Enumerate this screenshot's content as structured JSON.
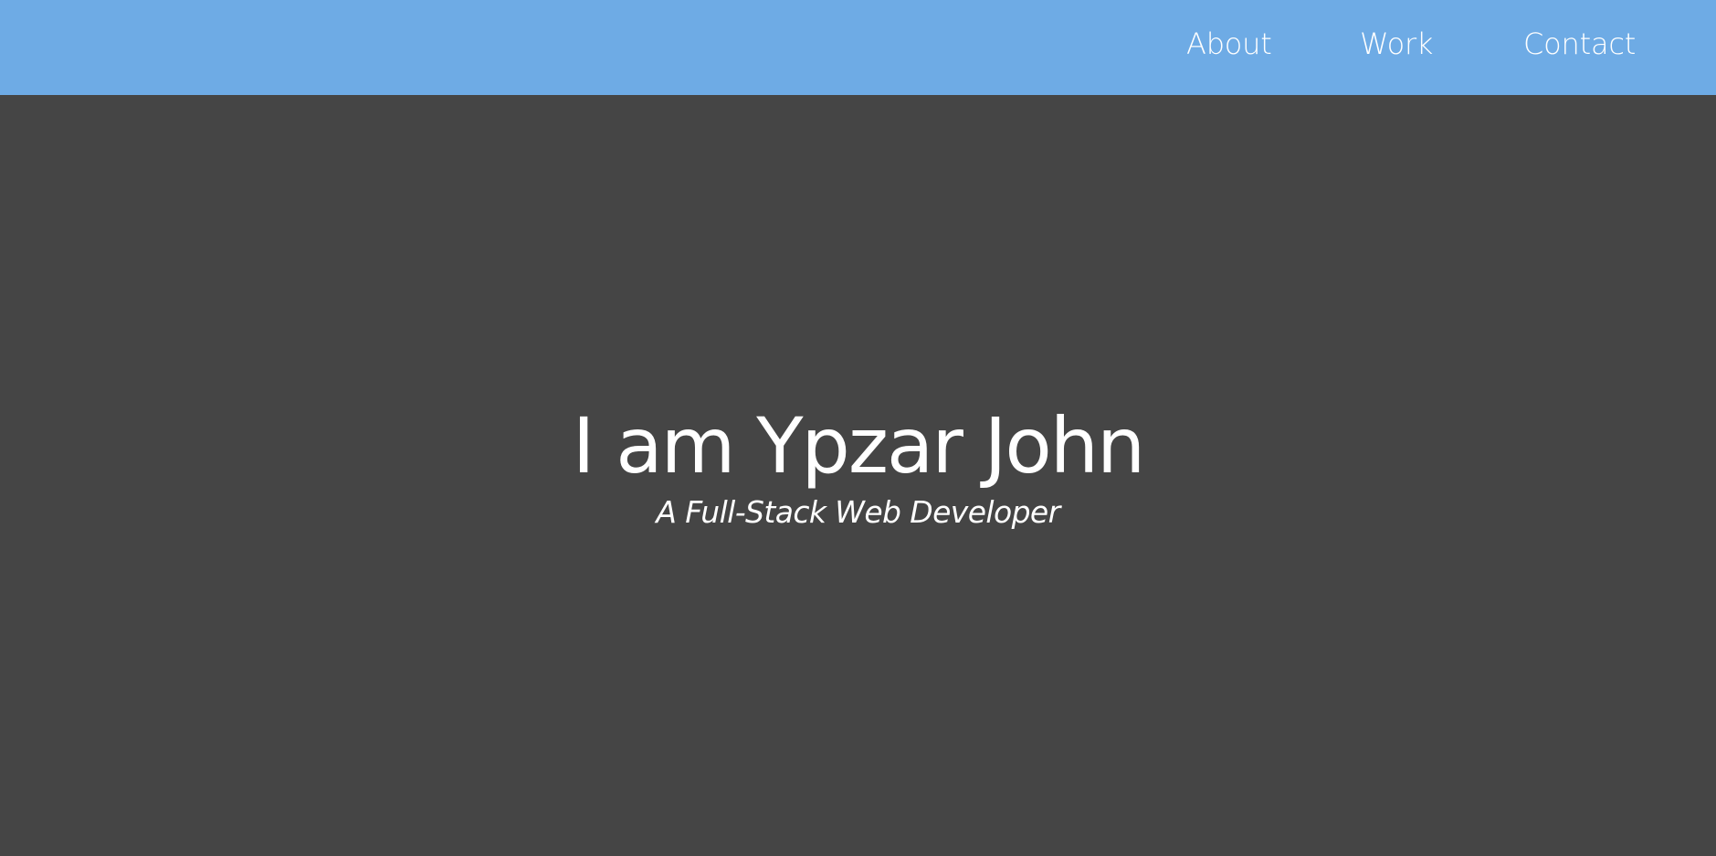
{
  "nav": {
    "items": [
      {
        "label": "About"
      },
      {
        "label": "Work"
      },
      {
        "label": "Contact"
      }
    ]
  },
  "hero": {
    "title": "I am Ypzar John",
    "subtitle": "A Full-Stack Web Developer"
  },
  "colors": {
    "navbar_background": "#6eabe5",
    "page_background": "#454545",
    "text": "#ffffff"
  }
}
